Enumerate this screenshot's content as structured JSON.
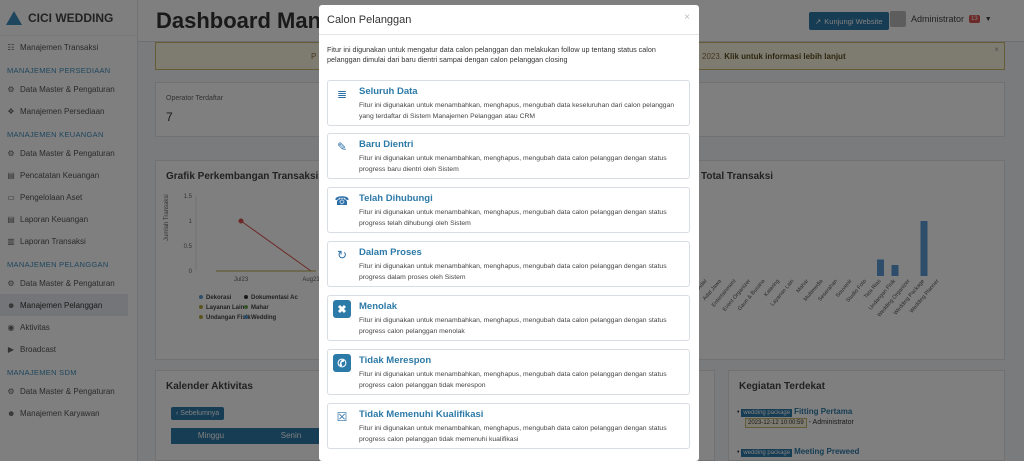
{
  "app": {
    "brand": "CICI WEDDING"
  },
  "sidebar": {
    "items": [
      {
        "type": "item",
        "label": "Manajemen Transaksi",
        "icon": "cart-icon",
        "glyph": "☷"
      },
      {
        "type": "head",
        "label": "MANAJEMEN PERSEDIAAN"
      },
      {
        "type": "item",
        "label": "Data Master & Pengaturan",
        "icon": "gear-icon",
        "glyph": "⚙"
      },
      {
        "type": "item",
        "label": "Manajemen Persediaan",
        "icon": "cubes-icon",
        "glyph": "❖"
      },
      {
        "type": "head",
        "label": "MANAJEMEN KEUANGAN"
      },
      {
        "type": "item",
        "label": "Data Master & Pengaturan",
        "icon": "gear-icon",
        "glyph": "⚙"
      },
      {
        "type": "item",
        "label": "Pencatatan Keuangan",
        "icon": "money-icon",
        "glyph": "▤"
      },
      {
        "type": "item",
        "label": "Pengelolaan Aset",
        "icon": "box-icon",
        "glyph": "▭"
      },
      {
        "type": "item",
        "label": "Laporan Keuangan",
        "icon": "card-icon",
        "glyph": "▤"
      },
      {
        "type": "item",
        "label": "Laporan Transaksi",
        "icon": "book-icon",
        "glyph": "▥"
      },
      {
        "type": "head",
        "label": "MANAJEMEN PELANGGAN"
      },
      {
        "type": "item",
        "label": "Data Master & Pengaturan",
        "icon": "gear-icon",
        "glyph": "⚙"
      },
      {
        "type": "item",
        "label": "Manajemen Pelanggan",
        "icon": "users-icon",
        "glyph": "☻",
        "active": true
      },
      {
        "type": "item",
        "label": "Aktivitas",
        "icon": "activity-icon",
        "glyph": "◉"
      },
      {
        "type": "item",
        "label": "Broadcast",
        "icon": "broadcast-icon",
        "glyph": "▶"
      },
      {
        "type": "head",
        "label": "MANAJEMEN SDM"
      },
      {
        "type": "item",
        "label": "Data Master & Pengaturan",
        "icon": "gear-icon",
        "glyph": "⚙"
      },
      {
        "type": "item",
        "label": "Manajemen Karyawan",
        "icon": "users-icon",
        "glyph": "☻"
      }
    ]
  },
  "header": {
    "title": "Dashboard Manaje",
    "visit_button": "Kunjungi Website",
    "user": "Administrator",
    "notif_count": "13"
  },
  "alert": {
    "left": "P",
    "right_prefix": "2023.",
    "right_link": "Klik untuk informasi lebih lanjut"
  },
  "stats": {
    "operator_label": "Operator Terdaftar",
    "operator_value": "7"
  },
  "panels": {
    "chart_title": "Grafik Perkembangan Transaksi P",
    "total_title": "Total Transaksi",
    "calendar_title": "Kalender Aktivitas",
    "prev_button": "‹ Sebelumnya",
    "days": [
      "Minggu",
      "Senin"
    ],
    "upcoming_title": "Kegiatan Terdekat",
    "events": [
      {
        "tag": "wedding package",
        "name": "Fitting Pertama",
        "date": "2023-12-12 10:00:59",
        "by": "- Administrator"
      },
      {
        "tag": "wedding package",
        "name": "Meeting Preweed"
      }
    ],
    "legend": [
      "Dekorasi",
      "Dokumentasi Ac",
      "Layanan Lain",
      "Mahar",
      "Undangan Fisik",
      "Wedding"
    ],
    "xlabels": [
      "Jul23",
      "Aug23"
    ],
    "ylabel": "Jumlah Transaksi",
    "yticks": [
      "1.5",
      "1",
      "0.5",
      "0"
    ],
    "bar_labels": [
      "Adat",
      "Adat Jawa",
      "Entertainment",
      "Event Organizer",
      "Gaun & Busana",
      "Katering",
      "Layanan Lain",
      "Mahar",
      "Multimedia",
      "Seserahan",
      "Souvenir",
      "Studio Foto",
      "Tata Rias",
      "Undangan Fisik",
      "Wedding Organizer",
      "Wedding Package",
      "Wedding Planner"
    ],
    "bar_values": [
      0,
      0,
      0,
      0,
      0,
      0,
      0,
      0,
      0,
      0,
      0,
      0,
      0.3,
      0.2,
      0,
      1,
      0
    ]
  },
  "modal": {
    "title": "Calon Pelanggan",
    "close": "×",
    "description": "Fitur ini digunakan untuk mengatur data calon pelanggan dan melakukan follow up tentang status calon pelanggan dimulai dari baru dientri sampai dengan calon pelanggan closing",
    "options": [
      {
        "title": "Seluruh Data",
        "desc": "Fitur ini digunakan untuk menambahkan, menghapus, mengubah data keseluruhan dari calon pelanggan yang terdaftar di Sistem Manajemen Pelanggan atau CRM",
        "icon": "database-icon",
        "glyph": "≣",
        "filled": false
      },
      {
        "title": "Baru Dientri",
        "desc": "Fitur ini digunakan untuk menambahkan, menghapus, mengubah data calon pelanggan dengan status progress baru dientri oleh Sistem",
        "icon": "edit-icon",
        "glyph": "✎",
        "filled": false
      },
      {
        "title": "Telah Dihubungi",
        "desc": "Fitur ini digunakan untuk menambahkan, menghapus, mengubah data calon pelanggan dengan status progress telah dihubungi oleh Sistem",
        "icon": "phone-ring-icon",
        "glyph": "☎",
        "filled": false
      },
      {
        "title": "Dalam Proses",
        "desc": "Fitur ini digunakan untuk menambahkan, menghapus, mengubah data calon pelanggan dengan status progress dalam proses oleh Sistem",
        "icon": "refresh-icon",
        "glyph": "↻",
        "filled": false
      },
      {
        "title": "Menolak",
        "desc": "Fitur ini digunakan untuk menambahkan, menghapus, mengubah data calon pelanggan dengan status progress calon pelanggan menolak",
        "icon": "reject-icon",
        "glyph": "✖",
        "filled": true
      },
      {
        "title": "Tidak Merespon",
        "desc": "Fitur ini digunakan untuk menambahkan, menghapus, mengubah data calon pelanggan dengan status progress calon pelanggan tidak merespon",
        "icon": "phone-icon",
        "glyph": "✆",
        "filled": true
      },
      {
        "title": "Tidak Memenuhi Kualifikasi",
        "desc": "Fitur ini digunakan untuk menambahkan, menghapus, mengubah data calon pelanggan dengan status progress calon pelanggan tidak memenuhi kualifikasi",
        "icon": "calendar-x-icon",
        "glyph": "☒",
        "filled": false
      }
    ]
  }
}
